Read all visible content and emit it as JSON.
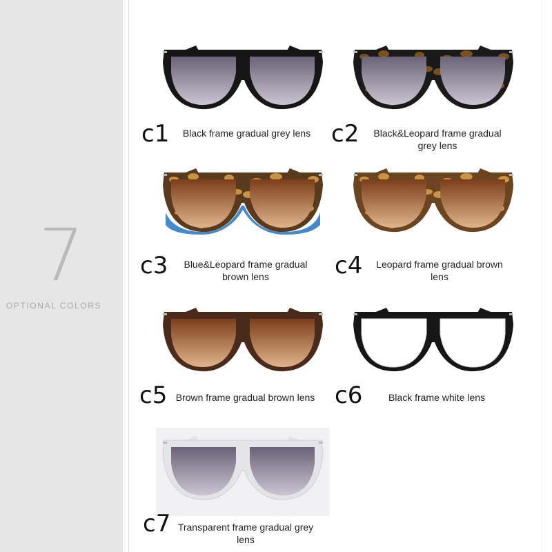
{
  "sidebar": {
    "number": "7",
    "caption": "OPTIONAL COLORS"
  },
  "options": [
    {
      "code": "c1",
      "description": "Black frame gradual grey lens",
      "frame": "black",
      "lens": "grey"
    },
    {
      "code": "c2",
      "description": "Black&Leopard frame gradual grey lens",
      "frame": "black-leopard",
      "lens": "grey"
    },
    {
      "code": "c3",
      "description": "Blue&Leopard frame gradual brown lens",
      "frame": "blue-leopard",
      "lens": "brown"
    },
    {
      "code": "c4",
      "description": "Leopard frame gradual brown lens",
      "frame": "leopard",
      "lens": "brown"
    },
    {
      "code": "c5",
      "description": "Brown frame gradual brown lens",
      "frame": "brown",
      "lens": "brown"
    },
    {
      "code": "c6",
      "description": "Black frame white lens",
      "frame": "black",
      "lens": "clear"
    },
    {
      "code": "c7",
      "description": "Transparent frame gradual grey lens",
      "frame": "transparent",
      "lens": "grey"
    }
  ],
  "colors": {
    "sidebar_bg": "#e6e6e6",
    "number_color": "#b9b9b9",
    "caption_color": "#a8a8a8"
  }
}
